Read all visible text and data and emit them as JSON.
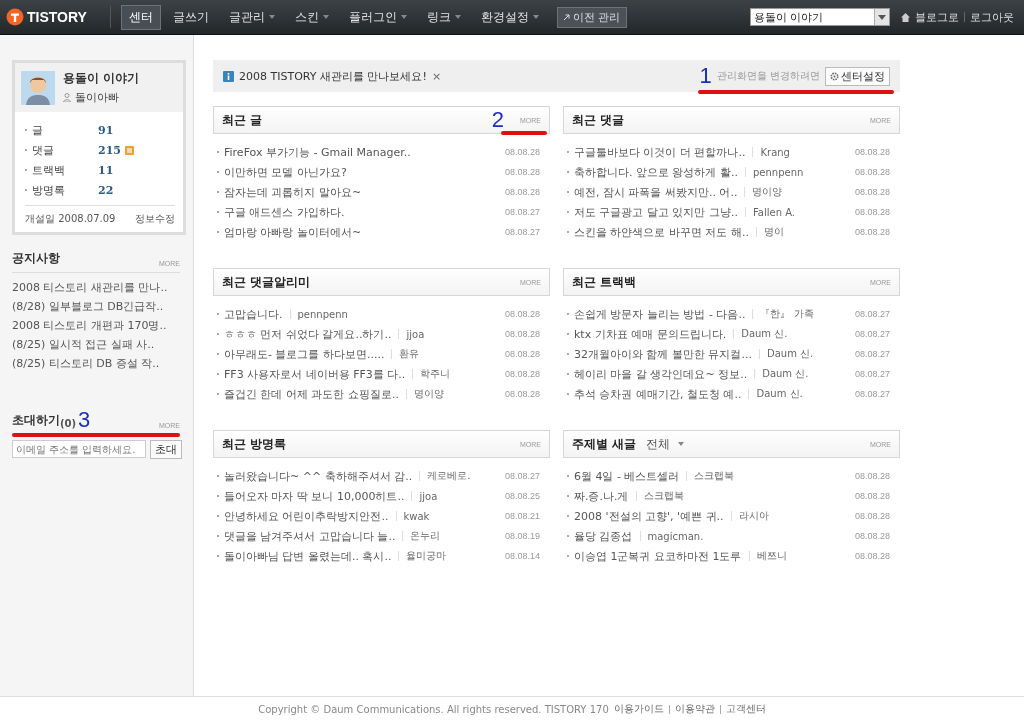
{
  "top_nav": {
    "logo": "TISTORY",
    "menu": [
      {
        "label": "센터",
        "selected": true,
        "dropdown": false
      },
      {
        "label": "글쓰기",
        "selected": false,
        "dropdown": false
      },
      {
        "label": "글관리",
        "selected": false,
        "dropdown": true
      },
      {
        "label": "스킨",
        "selected": false,
        "dropdown": true
      },
      {
        "label": "플러그인",
        "selected": false,
        "dropdown": true
      },
      {
        "label": "링크",
        "selected": false,
        "dropdown": true
      },
      {
        "label": "환경설정",
        "selected": false,
        "dropdown": true
      }
    ],
    "legacy_button": "이전 관리",
    "blog_select": "용돌이 이야기",
    "links": [
      "블로그로",
      "로그아웃"
    ]
  },
  "sidebar": {
    "profile": {
      "blog_name": "용돌이 이야기",
      "owner": "돌이아빠",
      "stats": [
        {
          "label": "글",
          "value": "91",
          "new_badge": false
        },
        {
          "label": "댓글",
          "value": "215",
          "new_badge": true
        },
        {
          "label": "트랙백",
          "value": "11",
          "new_badge": false
        },
        {
          "label": "방명록",
          "value": "22",
          "new_badge": false
        }
      ],
      "opened_label": "개설일",
      "opened_date": "2008.07.09",
      "edit_link": "정보수정"
    },
    "notices": {
      "title": "공지사항",
      "more": "MORE",
      "items": [
        "2008 티스토리 새관리를 만나..",
        "(8/28) 일부블로그 DB긴급작..",
        "2008 티스토리 개편과 170명..",
        "(8/25) 일시적 접근 실패 사..",
        "(8/25) 티스토리 DB 증설 작.."
      ]
    },
    "invite": {
      "title": "초대하기",
      "count": "(0)",
      "annotation": "3",
      "more": "MORE",
      "placeholder": "이메일 주소를 입력하세요.",
      "button": "초대"
    }
  },
  "banner": {
    "text": "2008 TISTORY 새관리를 만나보세요!",
    "close": "×",
    "annotation": "1",
    "hint": "관리화면을 변경하려면",
    "settings_button": "센터설정"
  },
  "panels": [
    {
      "title": "최근 글",
      "annotation": "2",
      "more": "MORE",
      "rows": [
        {
          "text": "FireFox 부가기능 - Gmail Manager..",
          "date": "08.08.28"
        },
        {
          "text": "이만하면 모델 아닌가요?",
          "date": "08.08.28"
        },
        {
          "text": "잠자는데 괴롭히지 말아요~",
          "date": "08.08.28"
        },
        {
          "text": "구글 애드센스 가입하다.",
          "date": "08.08.27"
        },
        {
          "text": "엄마랑 아빠랑 놀이터에서~",
          "date": "08.08.27"
        }
      ]
    },
    {
      "title": "최근 댓글",
      "more": "MORE",
      "rows": [
        {
          "text": "구글툴바보다 이것이 더 편할까나..",
          "author": "Krang",
          "date": "08.08.28"
        },
        {
          "text": "축하합니다. 앞으로 왕성하게 활..",
          "author": "pennpenn",
          "date": "08.08.28"
        },
        {
          "text": "예전, 잠시 파폭을 써봤지만.. 어..",
          "author": "명이양",
          "date": "08.08.28"
        },
        {
          "text": "저도 구글광고 달고 있지만 그냥..",
          "author": "Fallen A.",
          "date": "08.08.28"
        },
        {
          "text": "스킨을 하얀색으로 바꾸면 저도 해..",
          "author": "명이",
          "date": "08.08.28"
        }
      ]
    },
    {
      "title": "최근 댓글알리미",
      "more": "MORE",
      "rows": [
        {
          "text": "고맙습니다.",
          "author": "pennpenn",
          "date": "08.08.28"
        },
        {
          "text": "ㅎㅎㅎ 먼저 쉬었다 갈게요..하기..",
          "author": "jjoa",
          "date": "08.08.28"
        },
        {
          "text": "아무래도- 블로그를 하다보면.....",
          "author": "환유",
          "date": "08.08.28"
        },
        {
          "text": "FF3 사용자로서 네이버용 FF3를 다..",
          "author": "학주니",
          "date": "08.08.28"
        },
        {
          "text": "즐겁긴 한데 어제 과도한 쇼핑질로..",
          "author": "명이양",
          "date": "08.08.28"
        }
      ]
    },
    {
      "title": "최근 트랙백",
      "more": "MORE",
      "rows": [
        {
          "text": "손쉽게 방문자 늘리는 방법 - 다음..",
          "author": "『한』 가족",
          "date": "08.08.27"
        },
        {
          "text": "ktx 기차표 예매 문의드립니다.",
          "author": "Daum 신.",
          "date": "08.08.27"
        },
        {
          "text": "32개월아이와 함께 볼만한 뮤지컬...",
          "author": "Daum 신.",
          "date": "08.08.27"
        },
        {
          "text": "헤이리 마을 갈 생각인데요~ 정보..",
          "author": "Daum 신.",
          "date": "08.08.27"
        },
        {
          "text": "추석 승차권 예매기간, 철도청 예..",
          "author": "Daum 신.",
          "date": "08.08.27"
        }
      ]
    },
    {
      "title": "최근 방명록",
      "more": "MORE",
      "rows": [
        {
          "text": "놀러왔습니다~ ^^ 축하해주셔서 감..",
          "author": "케로베로.",
          "date": "08.08.27"
        },
        {
          "text": "들어오자 마자 딱 보니 10,000히트..",
          "author": "jjoa",
          "date": "08.08.25"
        },
        {
          "text": "안녕하세요 어린이추락방지안전..",
          "author": "kwak",
          "date": "08.08.21"
        },
        {
          "text": "댓글을 남겨주셔서 고맙습니다 늘..",
          "author": "온누리",
          "date": "08.08.19"
        },
        {
          "text": "돌이아빠님 답변 올렸는데.. 혹시..",
          "author": "율미궁마",
          "date": "08.08.14"
        }
      ]
    },
    {
      "title": "주제별 새글",
      "filter": "전체",
      "more": "MORE",
      "rows": [
        {
          "text": "6월 4일 - 베스트셀러",
          "author": "스크랩북",
          "date": "08.08.28"
        },
        {
          "text": "짜.증.나.게",
          "author": "스크랩북",
          "date": "08.08.28"
        },
        {
          "text": "2008 '전설의 고향', '예쁜 귀..",
          "author": "라시아",
          "date": "08.08.28"
        },
        {
          "text": "율당 김종섭",
          "author": "magicman.",
          "date": "08.08.28"
        },
        {
          "text": "이승엽 1군복귀 요코하마전 1도루",
          "author": "베쯔니",
          "date": "08.08.28"
        }
      ]
    }
  ],
  "footer": {
    "copyright": "Copyright © Daum Communications. All rights reserved. TISTORY 170",
    "links": [
      "이용가이드",
      "이용약관",
      "고객센터"
    ]
  }
}
